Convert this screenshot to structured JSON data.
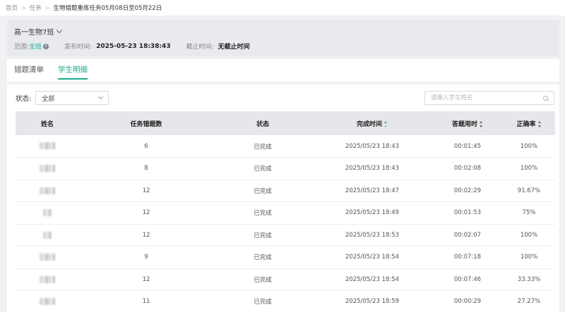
{
  "breadcrumb": {
    "home": "首页",
    "tasks": "任务",
    "current": "生物错题重练任务05月08日至05月22日",
    "separator": ">"
  },
  "class_panel": {
    "class_name": "高一生物7班",
    "range_label": "范围:",
    "range_value": "全班",
    "publish_label": "发布时间:",
    "publish_value": "2025-05-23 18:38:43",
    "deadline_label": "截止时间:",
    "deadline_value": "无截止时间",
    "info_icon": "info-icon"
  },
  "tabs": [
    {
      "label": "错题清单",
      "active": false
    },
    {
      "label": "学生明细",
      "active": true
    }
  ],
  "filter": {
    "status_label": "状态:",
    "status_value": "全部",
    "search_placeholder": "请输入学生姓名"
  },
  "table": {
    "headers": {
      "name": "姓名",
      "wrong_count": "任务错题数",
      "status": "状态",
      "completed_time": "完成时间",
      "duration": "答题用时",
      "accuracy": "正确率"
    },
    "rows": [
      {
        "wrong_count": "6",
        "status": "已完成",
        "completed_time": "2025/05/23 18:43",
        "duration": "00:01:45",
        "accuracy": "100%"
      },
      {
        "wrong_count": "8",
        "status": "已完成",
        "completed_time": "2025/05/23 18:43",
        "duration": "00:02:08",
        "accuracy": "100%"
      },
      {
        "wrong_count": "12",
        "status": "已完成",
        "completed_time": "2025/05/23 18:47",
        "duration": "00:02:29",
        "accuracy": "91.67%"
      },
      {
        "wrong_count": "12",
        "status": "已完成",
        "completed_time": "2025/05/23 18:49",
        "duration": "00:01:53",
        "accuracy": "75%"
      },
      {
        "wrong_count": "12",
        "status": "已完成",
        "completed_time": "2025/05/23 18:53",
        "duration": "00:02:07",
        "accuracy": "100%"
      },
      {
        "wrong_count": "9",
        "status": "已完成",
        "completed_time": "2025/05/23 18:54",
        "duration": "00:07:18",
        "accuracy": "100%"
      },
      {
        "wrong_count": "12",
        "status": "已完成",
        "completed_time": "2025/05/23 18:54",
        "duration": "00:07:46",
        "accuracy": "33.33%"
      },
      {
        "wrong_count": "11",
        "status": "已完成",
        "completed_time": "2025/05/23 18:59",
        "duration": "00:00:29",
        "accuracy": "27.27%"
      }
    ]
  },
  "colors": {
    "accent": "#1aaa8f",
    "header_bg": "#e6e7ea",
    "panel_bg": "#e9eaed"
  }
}
